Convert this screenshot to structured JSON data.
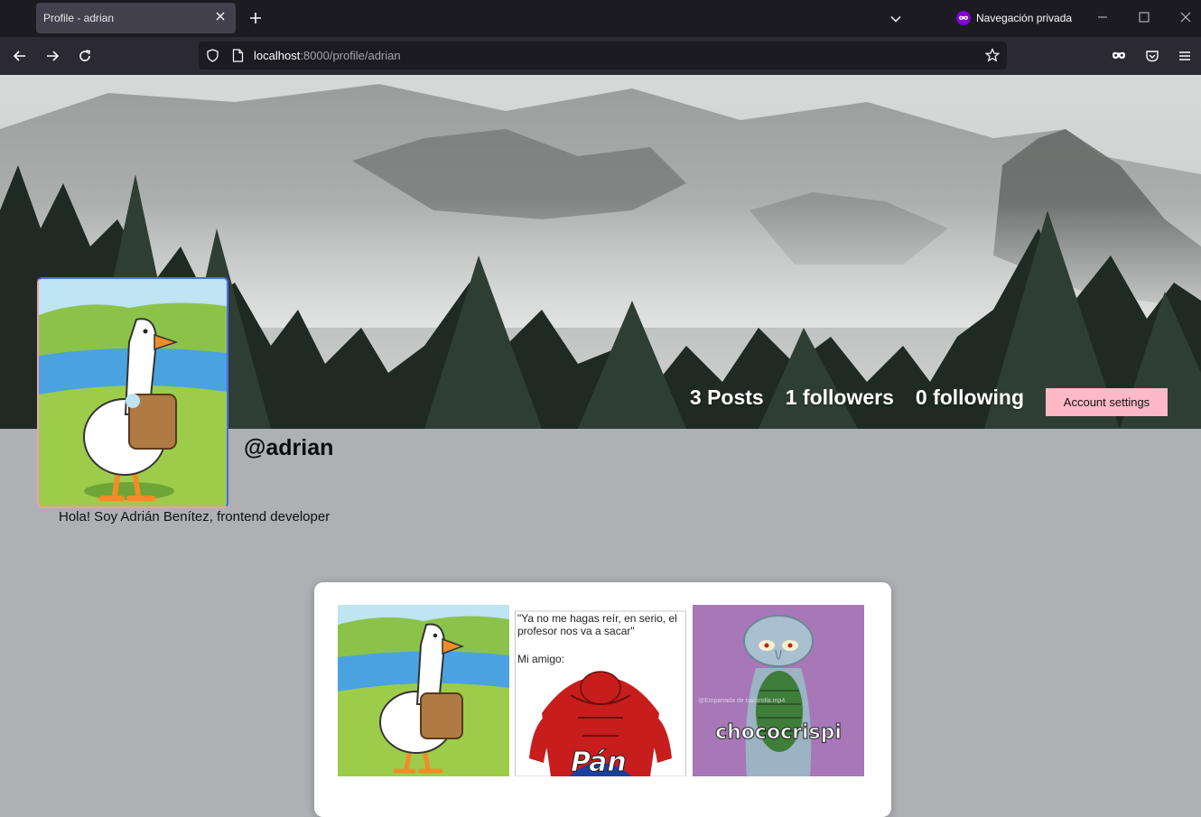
{
  "browser": {
    "tab_title": "Profile - adrian",
    "private_label": "Navegación privada",
    "url_host": "localhost",
    "url_rest": ":8000/profile/adrian"
  },
  "profile": {
    "posts_label": "3 Posts",
    "followers_label": "1 followers",
    "following_label": "0 following",
    "settings_label": "Account settings",
    "username": "@adrian",
    "bio": "Hola! Soy Adrián Benítez, frontend developer"
  },
  "posts": {
    "post2_caption_line1": "\"Ya no me hagas reír, en serio, el",
    "post2_caption_line2": "profesor nos va a sacar\"",
    "post2_caption_line3": "Mi amigo:",
    "post2_overlay": "Pán",
    "post3_watermark": "@Empanada de cacorolla.mp4",
    "post3_overlay": "chococrispi"
  },
  "colors": {
    "tabbar_bg": "#1c1b22",
    "navbar_bg": "#2b2a33",
    "page_bg": "#aeb0b4",
    "settings_button": "#ffb8c6",
    "private_accent": "#8000d7"
  },
  "icons": [
    "close-icon",
    "plus-icon",
    "chevron-down-icon",
    "private-mask-icon",
    "minimize-icon",
    "maximize-icon",
    "window-close-icon",
    "back-arrow-icon",
    "forward-arrow-icon",
    "reload-icon",
    "shield-icon",
    "page-icon",
    "star-icon",
    "mask-icon",
    "pocket-icon",
    "menu-icon"
  ]
}
